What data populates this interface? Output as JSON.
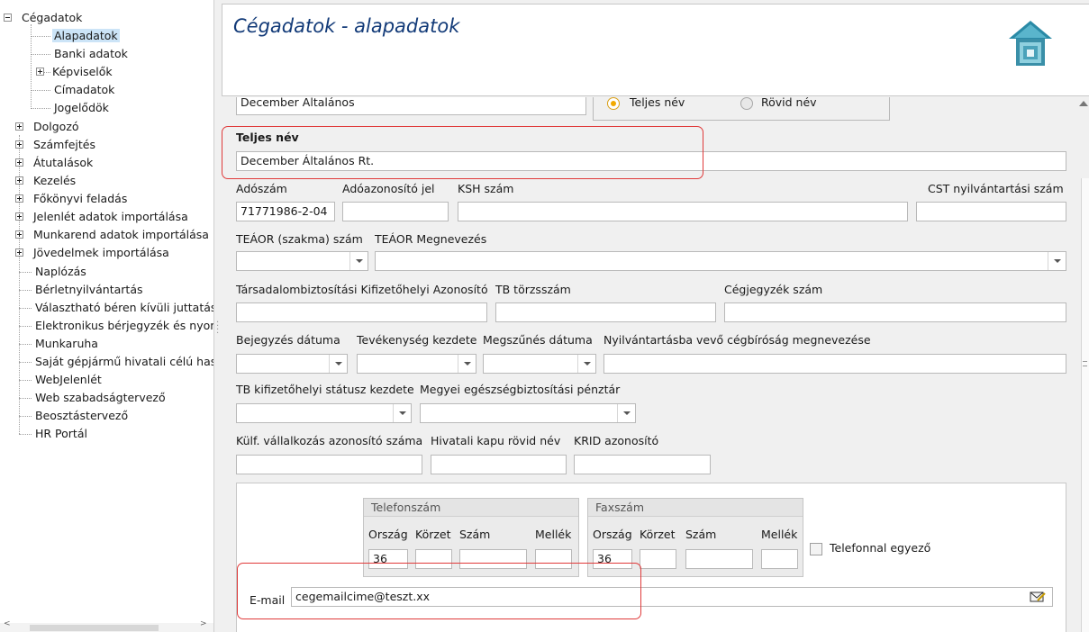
{
  "tree": {
    "items": [
      {
        "label": "Cégadatok"
      },
      {
        "label": "Alapadatok"
      },
      {
        "label": "Banki adatok"
      },
      {
        "label": "Képviselők"
      },
      {
        "label": "Címadatok"
      },
      {
        "label": "Jogelődök"
      },
      {
        "label": "Dolgozó"
      },
      {
        "label": "Számfejtés"
      },
      {
        "label": "Átutalások"
      },
      {
        "label": "Kezelés"
      },
      {
        "label": "Főkönyvi feladás"
      },
      {
        "label": "Jelenlét adatok importálása"
      },
      {
        "label": "Munkarend adatok importálása"
      },
      {
        "label": "Jövedelmek importálása"
      },
      {
        "label": "Naplózás"
      },
      {
        "label": "Bérletnyilvántartás"
      },
      {
        "label": "Választható béren kívüli juttatás"
      },
      {
        "label": "Elektronikus bérjegyzék és nyomtatás"
      },
      {
        "label": "Munkaruha"
      },
      {
        "label": "Saját gépjármű hivatali célú használata"
      },
      {
        "label": "WebJelenlét"
      },
      {
        "label": "Web szabadságtervező"
      },
      {
        "label": "Beosztástervező"
      },
      {
        "label": "HR Portál"
      }
    ]
  },
  "header": {
    "title": "Cégadatok - alapadatok",
    "logo_icon": "house-logo-icon"
  },
  "form": {
    "short_name_value": "December Általános",
    "name_radio": {
      "full": "Teljes név",
      "short": "Rövid név",
      "selected": "full"
    },
    "full_name_label": "Teljes név",
    "full_name_value": "December Általános Rt.",
    "tax_number_label": "Adószám",
    "tax_number_value": "71771986-2-04",
    "tax_id_label": "Adóazonosító jel",
    "ksh_label": "KSH szám",
    "cst_label": "CST nyilvántartási szám",
    "teaor_code_label": "TEÁOR (szakma) szám",
    "teaor_name_label": "TEÁOR Megnevezés",
    "social_security_label": "Társadalombiztosítási Kifizetőhelyi Azonosító",
    "tb_register_label": "TB törzsszám",
    "company_register_label": "Cégjegyzék szám",
    "registration_date_label": "Bejegyzés dátuma",
    "activity_start_label": "Tevékenység kezdete",
    "termination_date_label": "Megszűnés dátuma",
    "court_label": "Nyilvántartásba vevő cégbíróság megnevezése",
    "tb_status_label": "TB kifizetőhelyi státusz kezdete",
    "health_fund_label": "Megyei egészségbiztosítási pénztár",
    "foreign_id_label": "Külf. vállalkozás azonosító száma",
    "office_gate_label": "Hivatali kapu rövid név",
    "krid_label": "KRID azonosító"
  },
  "contact": {
    "phone_group": "Telefonszám",
    "fax_group": "Faxszám",
    "country_label": "Ország",
    "area_label": "Körzet",
    "number_label": "Szám",
    "extension_label": "Mellék",
    "phone_country_value": "36",
    "fax_country_value": "36",
    "same_as_phone_label": "Telefonnal egyező",
    "email_label": "E-mail",
    "email_value": "cegemailcime@teszt.xx",
    "mail_icon": "envelope-pen-icon"
  },
  "colors": {
    "title": "#123a78",
    "highlight": "#e03a3a",
    "selection": "#cce4f7",
    "radio_accent": "#f2a900"
  }
}
